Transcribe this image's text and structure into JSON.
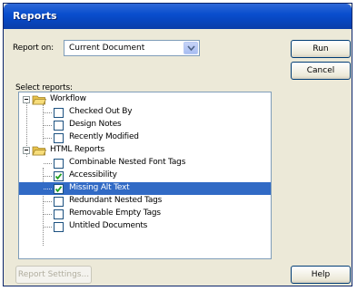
{
  "window": {
    "title": "Reports"
  },
  "report_on": {
    "label": "Report on:",
    "selected": "Current Document"
  },
  "buttons": {
    "run": "Run",
    "cancel": "Cancel",
    "report_settings": "Report Settings...",
    "help": "Help"
  },
  "select_reports_label": "Select reports:",
  "tree": [
    {
      "label": "Workflow",
      "type": "folder",
      "expanded": true,
      "children": [
        {
          "label": "Checked Out By",
          "checked": false
        },
        {
          "label": "Design Notes",
          "checked": false
        },
        {
          "label": "Recently Modified",
          "checked": false
        }
      ]
    },
    {
      "label": "HTML Reports",
      "type": "folder",
      "expanded": true,
      "children": [
        {
          "label": "Combinable Nested Font Tags",
          "checked": false
        },
        {
          "label": "Accessibility",
          "checked": true
        },
        {
          "label": "Missing Alt Text",
          "checked": true,
          "selected": true
        },
        {
          "label": "Redundant Nested Tags",
          "checked": false
        },
        {
          "label": "Removable Empty Tags",
          "checked": false
        },
        {
          "label": "Untitled Documents",
          "checked": false
        }
      ]
    }
  ],
  "colors": {
    "titlebar": "#0a4fce",
    "selection": "#316ac5",
    "dialog_bg": "#ece9d8"
  }
}
